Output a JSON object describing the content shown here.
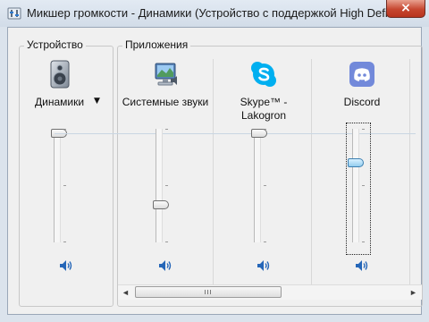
{
  "window": {
    "title": "Микшер громкости - Динамики (Устройство с поддержкой High Definit...",
    "close_glyph": "×"
  },
  "device_group": {
    "label": "Устройство",
    "device": {
      "label": "Динамики",
      "dropdown_glyph": "▼",
      "icon": "speaker-icon",
      "volume": 1.0
    }
  },
  "apps_group": {
    "label": "Приложения",
    "apps": [
      {
        "label": "Системные звуки",
        "icon": "system-sounds-icon",
        "volume": 0.32
      },
      {
        "label": "Skype™ - Lakogron",
        "icon": "skype-icon",
        "volume": 1.0
      },
      {
        "label": "Discord",
        "icon": "discord-icon",
        "volume": 0.72
      }
    ]
  },
  "mute_icon": "speaker-volume-icon",
  "scrollbar": {
    "left_glyph": "◄",
    "right_glyph": "►"
  },
  "colors": {
    "skype": "#00aff0",
    "discord": "#7289da",
    "focus_thumb": "#93cdee"
  }
}
